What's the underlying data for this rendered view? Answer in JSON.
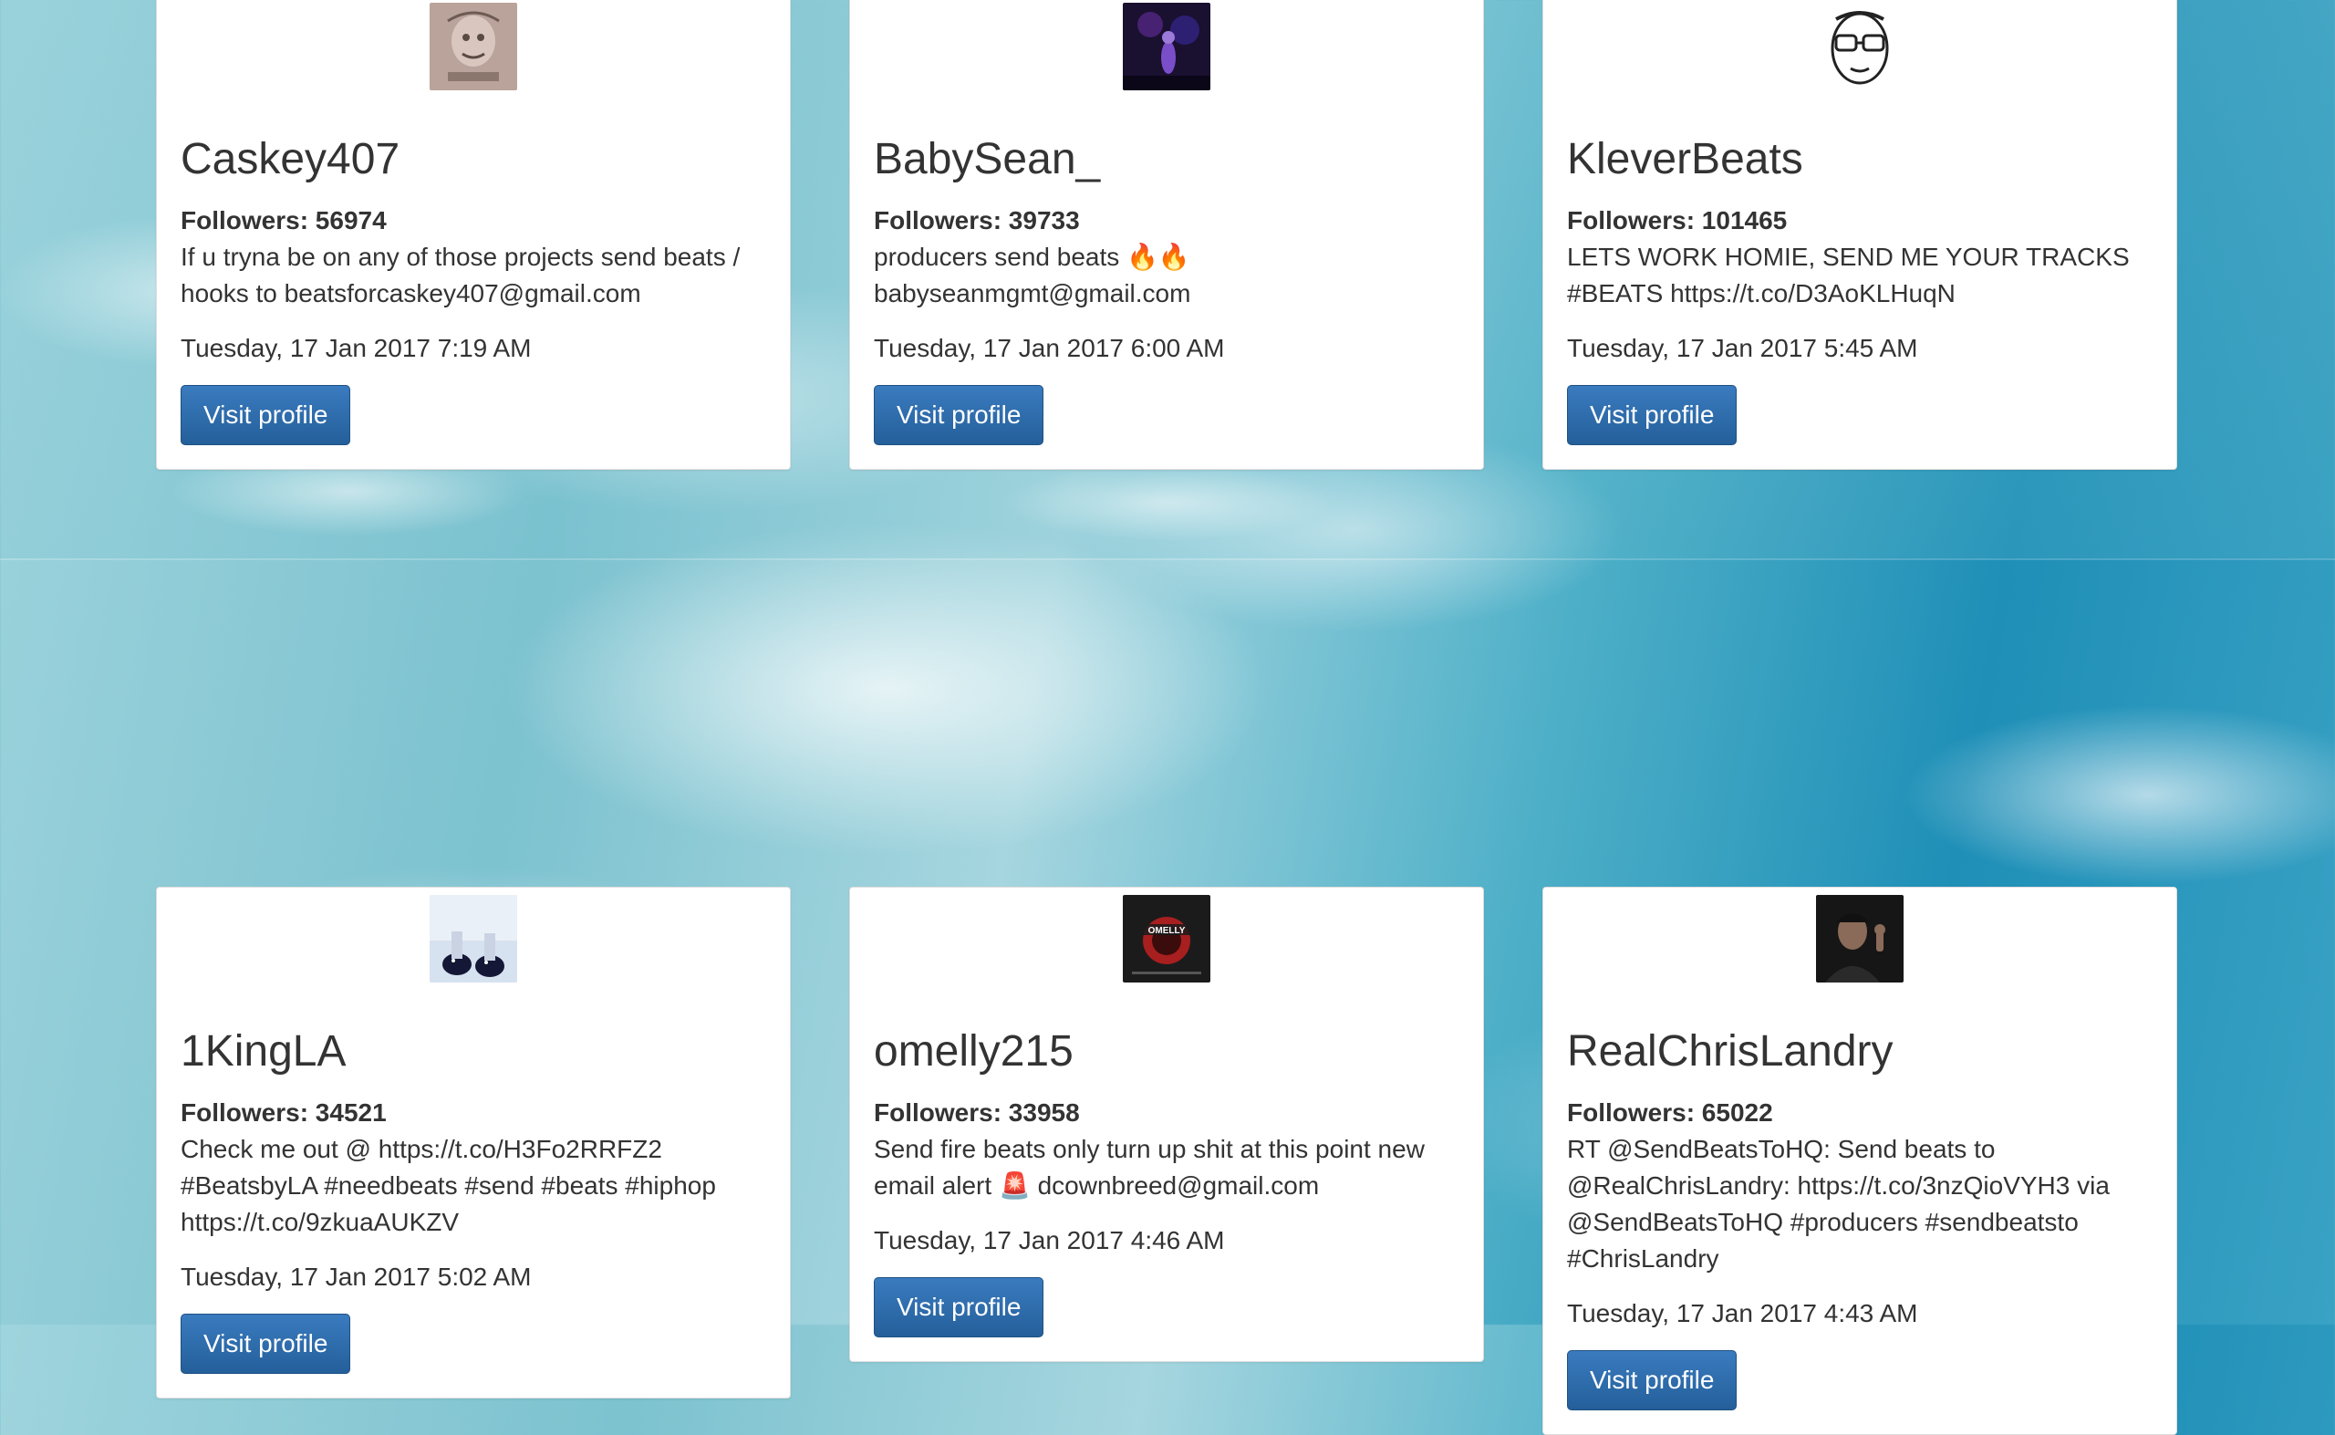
{
  "cards": [
    {
      "name": "Caskey407",
      "followers_label": "Followers:",
      "followers": "56974",
      "bio": "If u tryna be on any of those projects send beats / hooks to beatsforcaskey407@gmail.com",
      "date": "Tuesday, 17 Jan 2017 7:19 AM",
      "button": "Visit profile",
      "avatar_icon": "sketch-avatar-icon"
    },
    {
      "name": "BabySean_",
      "followers_label": "Followers:",
      "followers": "39733",
      "bio": "producers send beats 🔥🔥 babyseanmgmt@gmail.com",
      "date": "Tuesday, 17 Jan 2017 6:00 AM",
      "button": "Visit profile",
      "avatar_icon": "stage-avatar-icon"
    },
    {
      "name": "KleverBeats",
      "followers_label": "Followers:",
      "followers": "101465",
      "bio": "LETS WORK HOMIE, SEND ME YOUR TRACKS #BEATS https://t.co/D3AoKLHuqN",
      "date": "Tuesday, 17 Jan 2017 5:45 AM",
      "button": "Visit profile",
      "avatar_icon": "glasses-face-avatar-icon"
    },
    {
      "name": "1KingLA",
      "followers_label": "Followers:",
      "followers": "34521",
      "bio": "Check me out @ https://t.co/H3Fo2RRFZ2 #BeatsbyLA #needbeats #send #beats #hiphop https://t.co/9zkuaAUKZV",
      "date": "Tuesday, 17 Jan 2017 5:02 AM",
      "button": "Visit profile",
      "avatar_icon": "sneakers-avatar-icon"
    },
    {
      "name": "omelly215",
      "followers_label": "Followers:",
      "followers": "33958",
      "bio": "Send fire beats only turn up shit at this point new email alert 🚨 dcownbreed@gmail.com",
      "date": "Tuesday, 17 Jan 2017 4:46 AM",
      "button": "Visit profile",
      "avatar_icon": "album-cover-avatar-icon",
      "avatar_text": "OMELLY"
    },
    {
      "name": "RealChrisLandry",
      "followers_label": "Followers:",
      "followers": "65022",
      "bio": "RT @SendBeatsToHQ: Send beats to @RealChrisLandry: https://t.co/3nzQioVYH3 via @SendBeatsToHQ #producers #sendbeatsto #ChrisLandry",
      "date": "Tuesday, 17 Jan 2017 4:43 AM",
      "button": "Visit profile",
      "avatar_icon": "portrait-avatar-icon"
    }
  ]
}
